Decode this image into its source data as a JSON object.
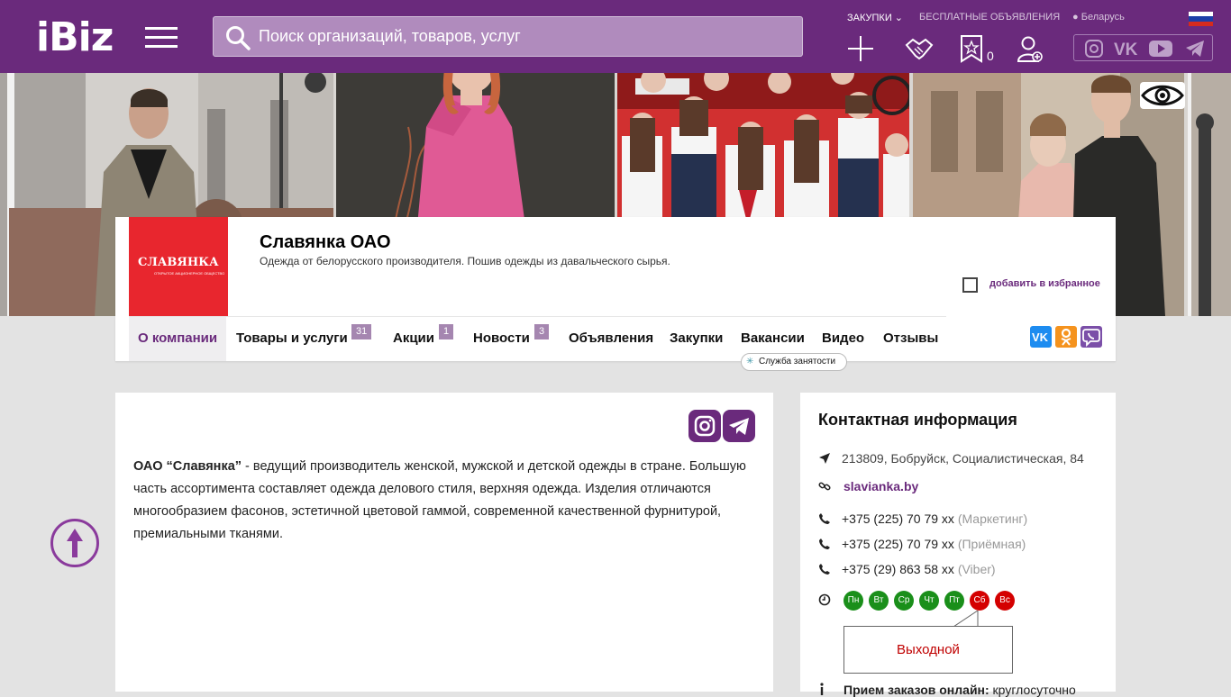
{
  "header": {
    "logo": "iBiz",
    "search_placeholder": "Поиск организаций, товаров, услуг",
    "nav_purchases": "ЗАКУПКИ",
    "nav_free_ads": "БЕСПЛАТНЫЕ ОБЪЯВЛЕНИЯ",
    "region": "Беларусь",
    "favorites_count": "0",
    "brand_color": "#6a2a7c"
  },
  "company": {
    "logo_text": "СЛАВЯНКА",
    "logo_subtext": "ОТКРЫТОЕ АКЦИОНЕРНОЕ ОБЩЕСТВО",
    "name": "Славянка ОАО",
    "description": "Одежда от белорусского производителя. Пошив одежды из давальческого сырья.",
    "add_favorite": "добавить в избранное"
  },
  "tabs": [
    {
      "label": "О компании"
    },
    {
      "label": "Товары и услуги",
      "badge": "31"
    },
    {
      "label": "Акции",
      "badge": "1"
    },
    {
      "label": "Новости",
      "badge": "3"
    },
    {
      "label": "Объявления"
    },
    {
      "label": "Закупки"
    },
    {
      "label": "Вакансии"
    },
    {
      "label": "Видео"
    },
    {
      "label": "Отзывы"
    }
  ],
  "tooltip": "Служба занятости",
  "about": {
    "company_bold": "ОАО “Славянка”",
    "text": " - ведущий производитель женской, мужской и детской одежды в стране. Большую часть ассортимента составляет одежда делового стиля, верхняя одежда. Изделия отличаются многообразием фасонов, эстетичной цветовой гаммой, современной качественной фурнитурой, премиальными тканями."
  },
  "contact": {
    "title": "Контактная информация",
    "address": "213809, Бобруйск, Социалистическая, 84",
    "website": "slavianka.by",
    "phones": [
      {
        "number": "+375 (225) 70 79 xx",
        "note": "(Маркетинг)"
      },
      {
        "number": "+375 (225) 70 79 xx",
        "note": "(Приёмная)"
      },
      {
        "number": "+375 (29) 863 58 xx",
        "note": "(Viber)"
      }
    ],
    "days": [
      {
        "label": "Пн",
        "color": "#1a8f1a"
      },
      {
        "label": "Вт",
        "color": "#1a8f1a"
      },
      {
        "label": "Ср",
        "color": "#1a8f1a"
      },
      {
        "label": "Чт",
        "color": "#1a8f1a"
      },
      {
        "label": "Пт",
        "color": "#1a8f1a"
      },
      {
        "label": "Сб",
        "color": "#d40000"
      },
      {
        "label": "Вс",
        "color": "#d40000"
      }
    ],
    "today_status": "Выходной",
    "online_label": "Прием заказов онлайн:",
    "online_value": " круглосуточно"
  }
}
